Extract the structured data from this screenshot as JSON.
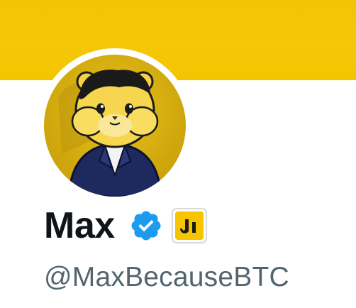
{
  "profile": {
    "display_name": "Max",
    "handle": "@MaxBecauseBTC",
    "avatar": "hamster-in-suit-avatar",
    "verified": true,
    "affiliate_badge": "yellow-logo-badge"
  },
  "icons": {
    "verified": "verified-badge-icon",
    "affiliate": "affiliate-logo-icon"
  },
  "colors": {
    "banner": "#f5c707",
    "name": "#0f1419",
    "handle": "#536471",
    "verified": "#1d9bf0",
    "affiliate": "#f6c500"
  }
}
